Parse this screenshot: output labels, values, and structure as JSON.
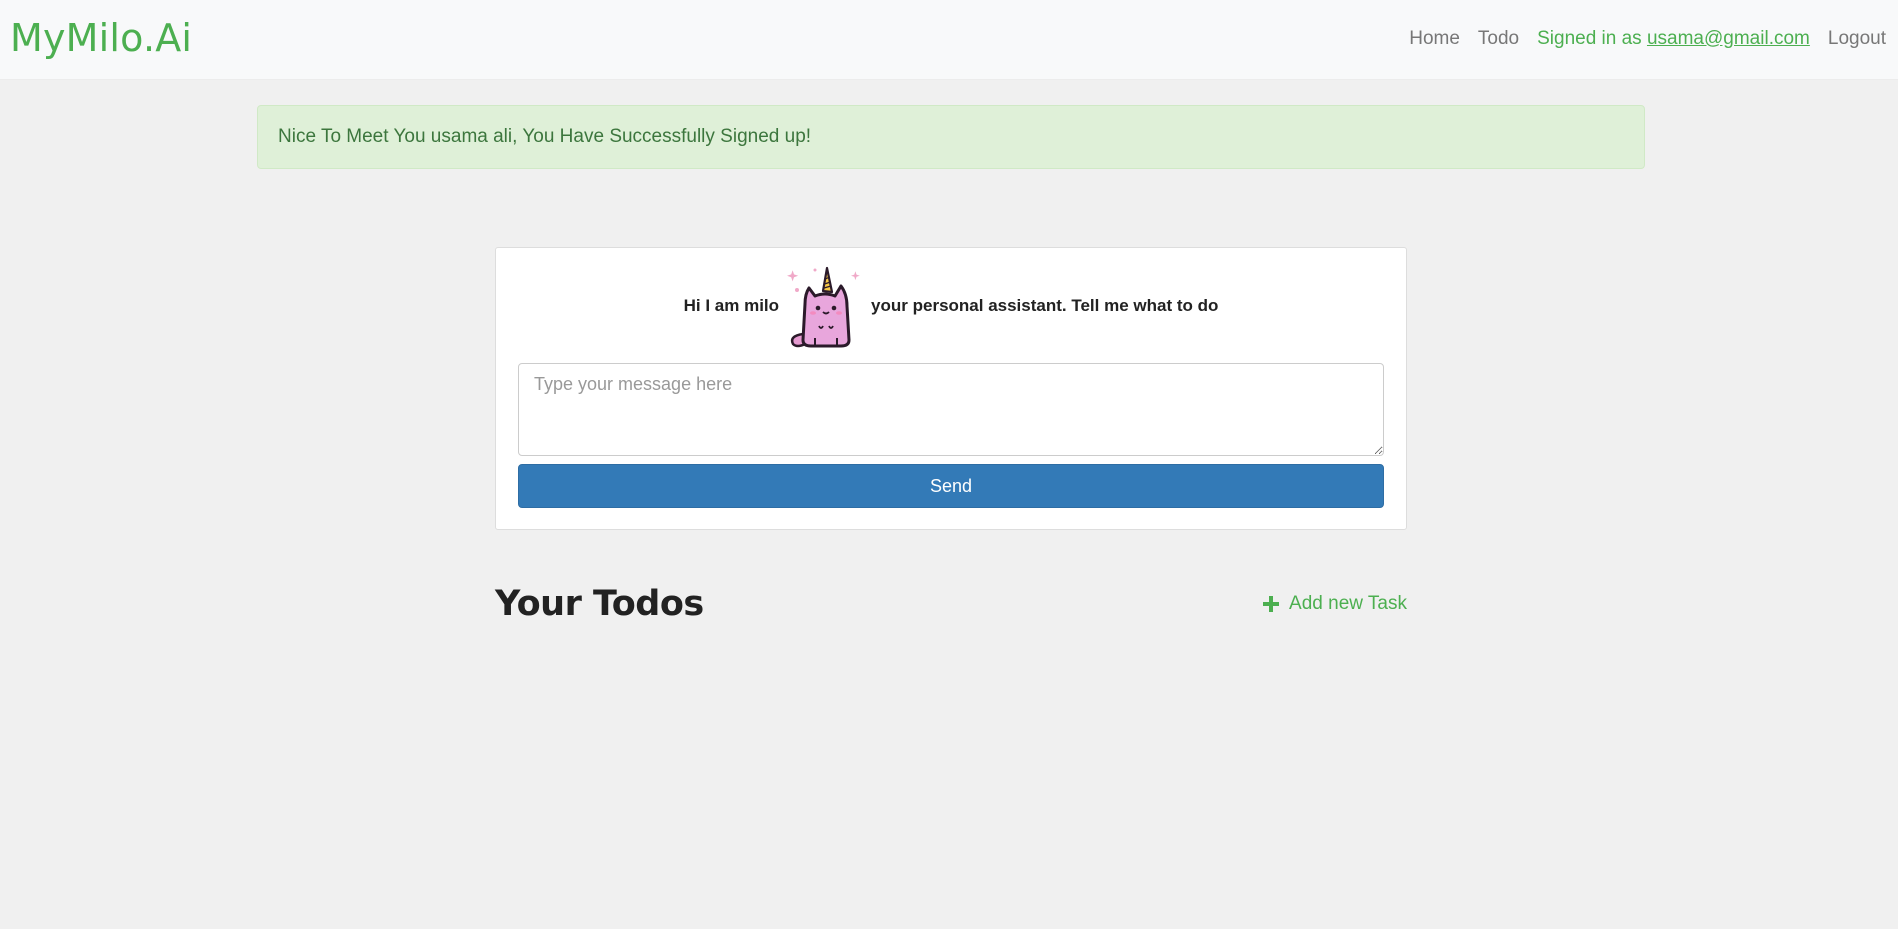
{
  "navbar": {
    "brand": "MyMilo.Ai",
    "links": {
      "home": "Home",
      "todo": "Todo",
      "signed_in_prefix": "Signed in as ",
      "email": "usama@gmail.com",
      "logout": "Logout"
    }
  },
  "alert": {
    "message": "Nice To Meet You usama ali, You Have Successfully Signed up!"
  },
  "chat": {
    "greeting_left": "Hi I am milo",
    "greeting_right": "your personal assistant. Tell me what to do",
    "mascot_icon": "unicorn-cat-icon",
    "input_placeholder": "Type your message here",
    "input_value": "",
    "send_label": "Send"
  },
  "todos": {
    "title": "Your Todos",
    "add_task_label": "Add new Task",
    "add_task_icon": "plus-icon"
  },
  "colors": {
    "brand": "#4caf50",
    "primary": "#337ab7",
    "alert_bg": "#dff0d8",
    "alert_text": "#3c763d",
    "page_bg": "#f0f0f0"
  }
}
